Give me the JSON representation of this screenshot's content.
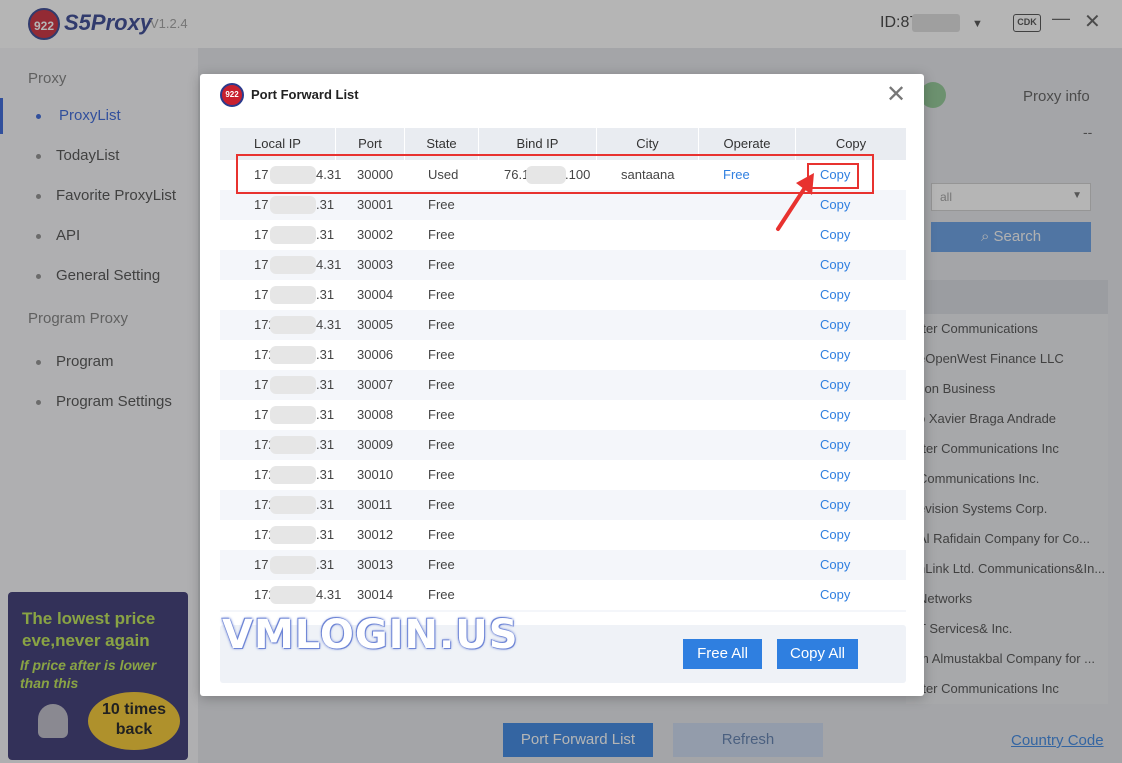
{
  "app": {
    "logo_text": "922",
    "brand": "S5Proxy",
    "version": "V1.2.4",
    "user_id": "ID:87",
    "cdk_label": "CDK",
    "minimize_glyph": "—",
    "close_glyph": "✕"
  },
  "sidebar": {
    "section_proxy": "Proxy",
    "items_proxy": [
      {
        "label": "ProxyList",
        "active": true
      },
      {
        "label": "TodayList"
      },
      {
        "label": "Favorite ProxyList"
      },
      {
        "label": "API"
      },
      {
        "label": "General Setting"
      }
    ],
    "section_program": "Program Proxy",
    "items_program": [
      {
        "label": "Program"
      },
      {
        "label": "Program Settings"
      }
    ],
    "promo": {
      "line1": "The lowest price",
      "line2": "eve,never again",
      "line3": "If price after is lower",
      "line4": "than this",
      "badge1": "10 times",
      "badge2": "back"
    }
  },
  "main": {
    "proxy_info_label": "Proxy info",
    "proxy_info_value": "--",
    "filter_value": "all",
    "search_label": "Search",
    "list_rows": [
      "rter Communications",
      "eOpenWest Finance LLC",
      "zon Business",
      "o Xavier Braga Andrade",
      "rter Communications Inc",
      "Communications Inc.",
      "evision Systems Corp.",
      "Al Rafidain Company for Co...",
      "nLink Ltd. Communications&In...",
      "Networks",
      "T Services& Inc.",
      "m Almustakbal Company for ...",
      "rter Communications Inc"
    ],
    "port_forward_list_label": "Port Forward List",
    "refresh_label": "Refresh",
    "country_code_label": "Country Code"
  },
  "modal": {
    "title": "Port Forward List",
    "close_glyph": "✕",
    "columns": [
      "Local IP",
      "Port",
      "State",
      "Bind IP",
      "City",
      "Operate",
      "Copy"
    ],
    "rows": [
      {
        "local_ip_prefix": "17",
        "local_ip_suffix": "4.31",
        "port": "30000",
        "state": "Used",
        "bind_ip_prefix": "76.1",
        "bind_ip_suffix": ".100",
        "city": "santaana",
        "operate": "Free",
        "copy": "Copy"
      },
      {
        "local_ip_prefix": "17",
        "local_ip_suffix": ".31",
        "port": "30001",
        "state": "Free",
        "bind_ip_prefix": "",
        "bind_ip_suffix": "",
        "city": "",
        "operate": "",
        "copy": "Copy"
      },
      {
        "local_ip_prefix": "17",
        "local_ip_suffix": ".31",
        "port": "30002",
        "state": "Free",
        "bind_ip_prefix": "",
        "bind_ip_suffix": "",
        "city": "",
        "operate": "",
        "copy": "Copy"
      },
      {
        "local_ip_prefix": "17",
        "local_ip_suffix": "4.31",
        "port": "30003",
        "state": "Free",
        "bind_ip_prefix": "",
        "bind_ip_suffix": "",
        "city": "",
        "operate": "",
        "copy": "Copy"
      },
      {
        "local_ip_prefix": "17",
        "local_ip_suffix": ".31",
        "port": "30004",
        "state": "Free",
        "bind_ip_prefix": "",
        "bind_ip_suffix": "",
        "city": "",
        "operate": "",
        "copy": "Copy"
      },
      {
        "local_ip_prefix": "172",
        "local_ip_suffix": "4.31",
        "port": "30005",
        "state": "Free",
        "bind_ip_prefix": "",
        "bind_ip_suffix": "",
        "city": "",
        "operate": "",
        "copy": "Copy"
      },
      {
        "local_ip_prefix": "172",
        "local_ip_suffix": ".31",
        "port": "30006",
        "state": "Free",
        "bind_ip_prefix": "",
        "bind_ip_suffix": "",
        "city": "",
        "operate": "",
        "copy": "Copy"
      },
      {
        "local_ip_prefix": "17",
        "local_ip_suffix": ".31",
        "port": "30007",
        "state": "Free",
        "bind_ip_prefix": "",
        "bind_ip_suffix": "",
        "city": "",
        "operate": "",
        "copy": "Copy"
      },
      {
        "local_ip_prefix": "17",
        "local_ip_suffix": ".31",
        "port": "30008",
        "state": "Free",
        "bind_ip_prefix": "",
        "bind_ip_suffix": "",
        "city": "",
        "operate": "",
        "copy": "Copy"
      },
      {
        "local_ip_prefix": "172",
        "local_ip_suffix": ".31",
        "port": "30009",
        "state": "Free",
        "bind_ip_prefix": "",
        "bind_ip_suffix": "",
        "city": "",
        "operate": "",
        "copy": "Copy"
      },
      {
        "local_ip_prefix": "172",
        "local_ip_suffix": ".31",
        "port": "30010",
        "state": "Free",
        "bind_ip_prefix": "",
        "bind_ip_suffix": "",
        "city": "",
        "operate": "",
        "copy": "Copy"
      },
      {
        "local_ip_prefix": "172",
        "local_ip_suffix": ".31",
        "port": "30011",
        "state": "Free",
        "bind_ip_prefix": "",
        "bind_ip_suffix": "",
        "city": "",
        "operate": "",
        "copy": "Copy"
      },
      {
        "local_ip_prefix": "172",
        "local_ip_suffix": ".31",
        "port": "30012",
        "state": "Free",
        "bind_ip_prefix": "",
        "bind_ip_suffix": "",
        "city": "",
        "operate": "",
        "copy": "Copy"
      },
      {
        "local_ip_prefix": "17",
        "local_ip_suffix": ".31",
        "port": "30013",
        "state": "Free",
        "bind_ip_prefix": "",
        "bind_ip_suffix": "",
        "city": "",
        "operate": "",
        "copy": "Copy"
      },
      {
        "local_ip_prefix": "172",
        "local_ip_suffix": "4.31",
        "port": "30014",
        "state": "Free",
        "bind_ip_prefix": "",
        "bind_ip_suffix": "",
        "city": "",
        "operate": "",
        "copy": "Copy"
      }
    ],
    "free_all_label": "Free All",
    "copy_all_label": "Copy All"
  },
  "watermark": "VMLOGIN.US",
  "colors": {
    "accent": "#2f7fe0",
    "highlight": "#e8322f",
    "brand": "#2b3a8c"
  }
}
